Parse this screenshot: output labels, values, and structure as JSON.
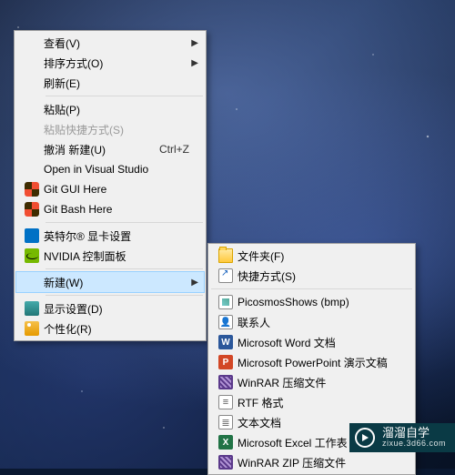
{
  "menu1": {
    "items": [
      {
        "label": "查看(V)",
        "has_submenu": true
      },
      {
        "label": "排序方式(O)",
        "has_submenu": true
      },
      {
        "label": "刷新(E)"
      },
      {
        "sep": true
      },
      {
        "label": "粘贴(P)"
      },
      {
        "label": "粘贴快捷方式(S)",
        "disabled": true
      },
      {
        "label": "撤消 新建(U)",
        "shortcut": "Ctrl+Z"
      },
      {
        "label": "Open in Visual Studio"
      },
      {
        "label": "Git GUI Here",
        "icon": "git"
      },
      {
        "label": "Git Bash Here",
        "icon": "git"
      },
      {
        "sep": true
      },
      {
        "label": "英特尔® 显卡设置",
        "icon": "intel"
      },
      {
        "label": "NVIDIA 控制面板",
        "icon": "nvidia"
      },
      {
        "sep": true
      },
      {
        "label": "新建(W)",
        "has_submenu": true,
        "highlighted": true
      },
      {
        "sep": true
      },
      {
        "label": "显示设置(D)",
        "icon": "display"
      },
      {
        "label": "个性化(R)",
        "icon": "personal"
      }
    ]
  },
  "menu2": {
    "items": [
      {
        "label": "文件夹(F)",
        "icon": "folder"
      },
      {
        "label": "快捷方式(S)",
        "icon": "shortcut"
      },
      {
        "sep": true
      },
      {
        "label": "PicosmosShows (bmp)",
        "icon": "bmp"
      },
      {
        "label": "联系人",
        "icon": "contact"
      },
      {
        "label": "Microsoft Word 文档",
        "icon": "word",
        "icoText": "W"
      },
      {
        "label": "Microsoft PowerPoint 演示文稿",
        "icon": "ppt",
        "icoText": "P"
      },
      {
        "label": "WinRAR 压缩文件",
        "icon": "rar"
      },
      {
        "label": "RTF 格式",
        "icon": "rtf"
      },
      {
        "label": "文本文档",
        "icon": "txt"
      },
      {
        "label": "Microsoft Excel 工作表",
        "icon": "excel",
        "icoText": "X"
      },
      {
        "label": "WinRAR ZIP 压缩文件",
        "icon": "rar"
      }
    ]
  },
  "watermark": {
    "title": "溜溜自学",
    "sub": "zixue.3d66.com"
  }
}
